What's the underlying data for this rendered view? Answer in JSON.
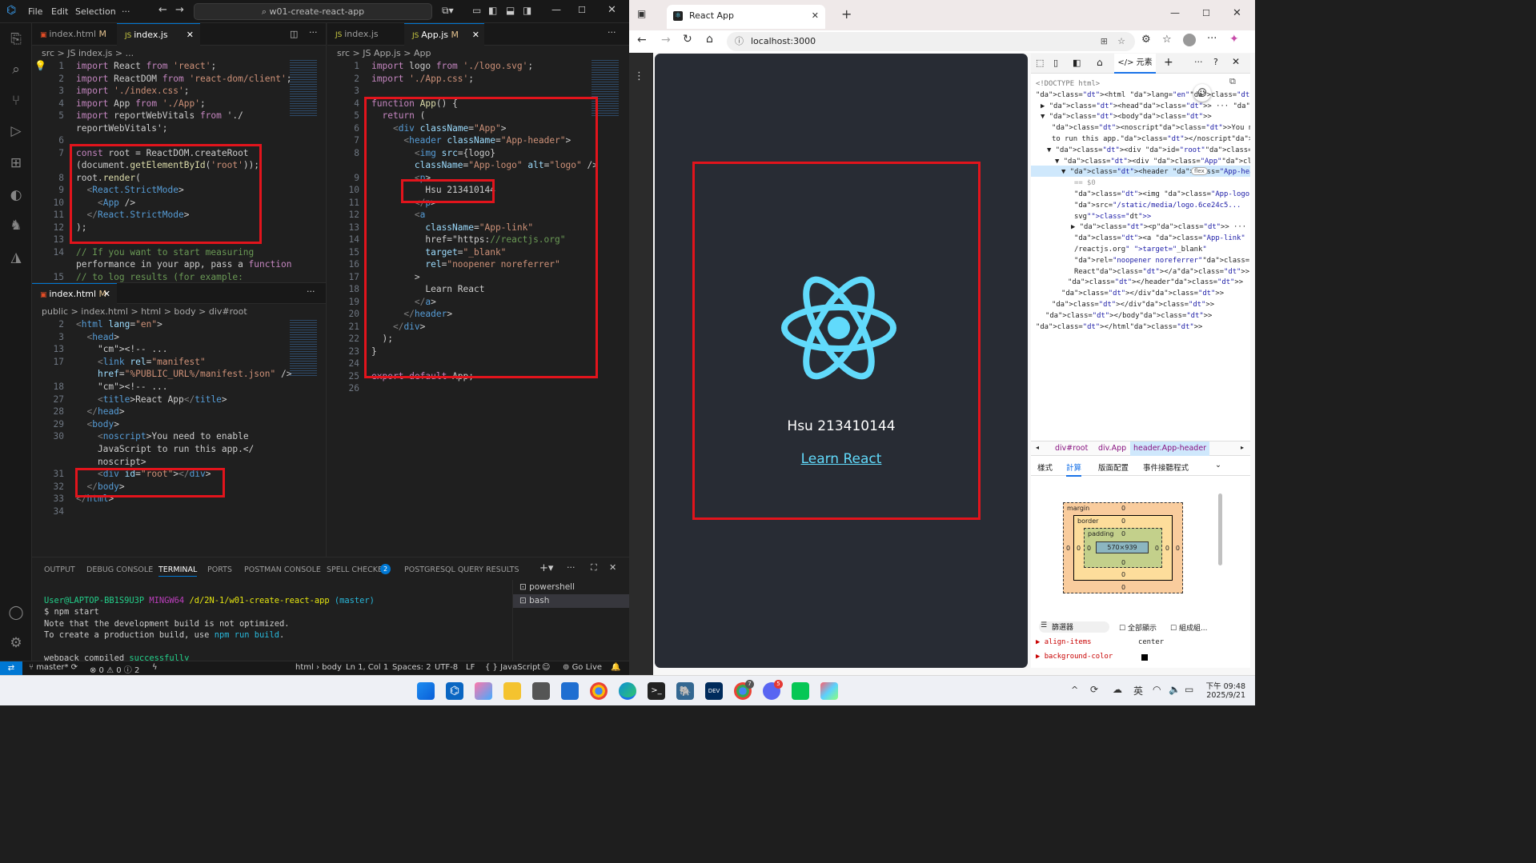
{
  "vscode": {
    "menu": [
      "File",
      "Edit",
      "Selection",
      "···"
    ],
    "command_center": "w01-create-react-app",
    "left_editor": {
      "tabs": [
        {
          "label": "index.html",
          "mod": "M"
        },
        {
          "label": "index.js",
          "mod": ""
        }
      ],
      "breadcrumb": "src > JS index.js > ...",
      "lines": [
        {
          "n": "1",
          "t": "import React from 'react';"
        },
        {
          "n": "2",
          "t": "import ReactDOM from 'react-dom/client';"
        },
        {
          "n": "3",
          "t": "import './index.css';"
        },
        {
          "n": "4",
          "t": "import App from './App';"
        },
        {
          "n": "5",
          "t": "import reportWebVitals from './"
        },
        {
          "n": "",
          "t": "reportWebVitals';"
        },
        {
          "n": "6",
          "t": ""
        },
        {
          "n": "7",
          "t": "const root = ReactDOM.createRoot"
        },
        {
          "n": "",
          "t": "(document.getElementById('root'));"
        },
        {
          "n": "8",
          "t": "root.render("
        },
        {
          "n": "9",
          "t": "  <React.StrictMode>"
        },
        {
          "n": "10",
          "t": "    <App />"
        },
        {
          "n": "11",
          "t": "  </React.StrictMode>"
        },
        {
          "n": "12",
          "t": ");"
        },
        {
          "n": "13",
          "t": ""
        },
        {
          "n": "14",
          "t": "// If you want to start measuring"
        },
        {
          "n": "",
          "t": "performance in your app, pass a function"
        },
        {
          "n": "15",
          "t": "// to log results (for example:"
        }
      ]
    },
    "html_editor": {
      "tabs": [
        {
          "label": "index.html",
          "mod": "M"
        }
      ],
      "breadcrumb": "public > index.html > html > body > div#root",
      "lines": [
        {
          "n": "2",
          "t": "<html lang=\"en\">"
        },
        {
          "n": "3",
          "t": "  <head>"
        },
        {
          "n": "13",
          "t": "    <!-- ..."
        },
        {
          "n": "17",
          "t": "    <link rel=\"manifest\""
        },
        {
          "n": "",
          "t": "    href=\"%PUBLIC_URL%/manifest.json\" />"
        },
        {
          "n": "18",
          "t": "    <!-- ..."
        },
        {
          "n": "27",
          "t": "    <title>React App</title>"
        },
        {
          "n": "28",
          "t": "  </head>"
        },
        {
          "n": "29",
          "t": "  <body>"
        },
        {
          "n": "30",
          "t": "    <noscript>You need to enable"
        },
        {
          "n": "",
          "t": "    JavaScript to run this app.</"
        },
        {
          "n": "",
          "t": "    noscript>"
        },
        {
          "n": "31",
          "t": "    <div id=\"root\"></div>"
        },
        {
          "n": "32",
          "t": "  </body>"
        },
        {
          "n": "33",
          "t": "</html>"
        },
        {
          "n": "34",
          "t": ""
        }
      ]
    },
    "right_editor": {
      "tabs": [
        {
          "label": "index.js",
          "mod": ""
        },
        {
          "label": "App.js",
          "mod": "M"
        }
      ],
      "breadcrumb": "src > JS App.js > App",
      "lines": [
        {
          "n": "1",
          "t": "import logo from './logo.svg';"
        },
        {
          "n": "2",
          "t": "import './App.css';"
        },
        {
          "n": "3",
          "t": ""
        },
        {
          "n": "4",
          "t": "function App() {"
        },
        {
          "n": "5",
          "t": "  return ("
        },
        {
          "n": "6",
          "t": "    <div className=\"App\">"
        },
        {
          "n": "7",
          "t": "      <header className=\"App-header\">"
        },
        {
          "n": "8",
          "t": "        <img src={logo}"
        },
        {
          "n": "",
          "t": "        className=\"App-logo\" alt=\"logo\" />"
        },
        {
          "n": "9",
          "t": "        <p>"
        },
        {
          "n": "10",
          "t": "          Hsu 213410144"
        },
        {
          "n": "11",
          "t": "        </p>"
        },
        {
          "n": "12",
          "t": "        <a"
        },
        {
          "n": "13",
          "t": "          className=\"App-link\""
        },
        {
          "n": "14",
          "t": "          href=\"https://reactjs.org\""
        },
        {
          "n": "15",
          "t": "          target=\"_blank\""
        },
        {
          "n": "16",
          "t": "          rel=\"noopener noreferrer\""
        },
        {
          "n": "17",
          "t": "        >"
        },
        {
          "n": "18",
          "t": "          Learn React"
        },
        {
          "n": "19",
          "t": "        </a>"
        },
        {
          "n": "20",
          "t": "      </header>"
        },
        {
          "n": "21",
          "t": "    </div>"
        },
        {
          "n": "22",
          "t": "  );"
        },
        {
          "n": "23",
          "t": "}"
        },
        {
          "n": "24",
          "t": ""
        },
        {
          "n": "25",
          "t": "export default App;"
        },
        {
          "n": "26",
          "t": ""
        }
      ]
    },
    "panel": {
      "tabs": [
        "OUTPUT",
        "DEBUG CONSOLE",
        "TERMINAL",
        "PORTS",
        "POSTMAN CONSOLE",
        "SPELL CHECKER",
        "POSTGRESQL QUERY RESULTS"
      ],
      "spell_badge": "2",
      "terminal": {
        "prompt_user": "User@LAPTOP-BB1S9U3P",
        "prompt_env": "MINGW64",
        "prompt_path": "/d/2N-1/w01-create-react-app",
        "prompt_branch": "(master)",
        "command": "$ npm start",
        "line1": "Note that the development build is not optimized.",
        "line2a": "To create a production build, use ",
        "line2b": "npm run build",
        "line2c": ".",
        "line3a": "webpack compiled ",
        "line3b": "successfully"
      },
      "shells": [
        "powershell",
        "bash"
      ]
    },
    "status": {
      "branch": "master*",
      "problems": "⊗ 0 ⚠ 0 ⓘ 2",
      "path": "html › body",
      "position": "Ln 1, Col 1",
      "spaces": "Spaces: 2",
      "encoding": "UTF-8",
      "eol": "LF",
      "language": "{ } JavaScript",
      "golive": "Go Live"
    }
  },
  "browser": {
    "tab_title": "React App",
    "url": "localhost:3000",
    "app_text": "Hsu 213410144",
    "app_link": "Learn React",
    "devtools": {
      "elements_tab": "元素",
      "dom": [
        "<!DOCTYPE html>",
        "<html lang=\"en\">",
        "▶ <head> ··· </head>",
        "▼ <body>",
        "<noscript>You need to enable JavaScript",
        "to run this app.</noscript>",
        "▼ <div id=\"root\">",
        "▼ <div class=\"App\">",
        "▼ <header class=\"App-header\">",
        "== $0",
        "<img class=\"App-logo\" alt=\"logo\"",
        "src=\"/static/media/logo.6ce24c5...",
        "svg\">",
        "▶ <p> ··· </p>",
        "<a class=\"App-link\" href=\"https:/",
        "/reactjs.org\" target=\"_blank\"",
        "rel=\"noopener noreferrer\">Learn",
        "React</a>",
        "</header>",
        "</div>",
        "</div>",
        "</body>",
        "</html>"
      ],
      "flex_badge": "flex",
      "breadcrumbs": [
        "div#root",
        "div.App",
        "header.App-header"
      ],
      "subtabs": [
        "樣式",
        "計算",
        "版面配置",
        "事件接聽程式"
      ],
      "boxmodel": {
        "margin": "margin",
        "border": "border",
        "padding": "padding",
        "content": "570×939",
        "zero": "0"
      },
      "filter": "篩選器",
      "show_all": "全部顯示",
      "group": "組成組...",
      "props": [
        {
          "name": "align-items",
          "value": "center"
        },
        {
          "name": "background-color",
          "value": ""
        }
      ]
    }
  },
  "taskbar": {
    "ime": "英",
    "time": "下午 09:48",
    "date": "2025/9/21",
    "badge_chrome": "7",
    "badge_discord": "5"
  },
  "colors": {
    "react": "#61dafb",
    "highlight": "#e2141c",
    "bg": "#282c34"
  }
}
